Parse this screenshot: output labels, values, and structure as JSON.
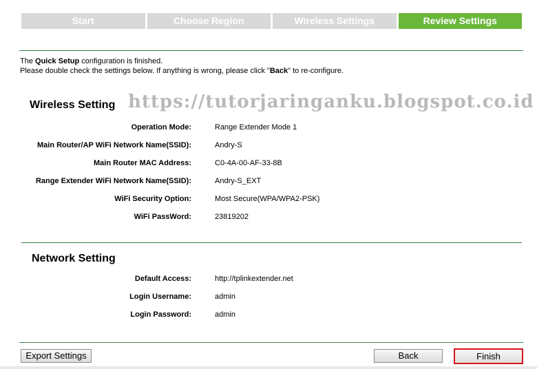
{
  "steps": [
    {
      "label": "Start",
      "active": false
    },
    {
      "label": "Choose Region",
      "active": false
    },
    {
      "label": "Wireless Settings",
      "active": false
    },
    {
      "label": "Review Settings",
      "active": true
    }
  ],
  "intro": {
    "line1_pre": "The ",
    "line1_bold": "Quick Setup",
    "line1_post": " configuration is finished.",
    "line2_pre": "Please double check the settings below. If anything is wrong, please click \"",
    "line2_bold": "Back",
    "line2_post": "\" to re-configure."
  },
  "watermark": "https://tutorjaringanku.blogspot.co.id",
  "wireless": {
    "title": "Wireless Setting",
    "rows": [
      {
        "label": "Operation Mode:",
        "value": "Range Extender Mode 1"
      },
      {
        "label": "Main Router/AP WiFi Network Name(SSID):",
        "value": "Andry-S"
      },
      {
        "label": "Main Router MAC Address:",
        "value": "C0-4A-00-AF-33-8B"
      },
      {
        "label": "Range Extender WiFi Network Name(SSID):",
        "value": "Andry-S_EXT"
      },
      {
        "label": "WiFi Security Option:",
        "value": "Most Secure(WPA/WPA2-PSK)"
      },
      {
        "label": "WiFi PassWord:",
        "value": "23819202"
      }
    ]
  },
  "network": {
    "title": "Network Setting",
    "rows": [
      {
        "label": "Default Access:",
        "value": "http://tplinkextender.net"
      },
      {
        "label": "Login Username:",
        "value": "admin"
      },
      {
        "label": "Login Password:",
        "value": "admin"
      }
    ]
  },
  "buttons": {
    "export": "Export Settings",
    "back": "Back",
    "finish": "Finish"
  },
  "colors": {
    "step_active": "#6ab73a",
    "step_inactive": "#d9d9d9",
    "divider": "#3a7d44",
    "finish_border": "#d8141b"
  }
}
